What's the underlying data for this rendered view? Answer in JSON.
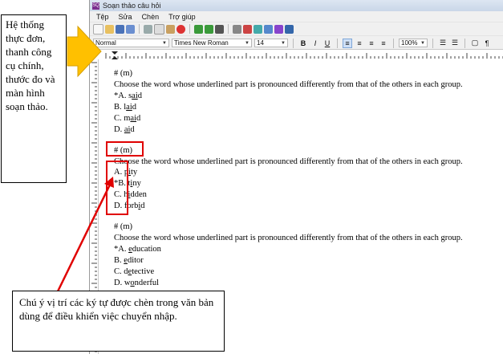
{
  "window": {
    "title": "Soạn thảo câu hỏi"
  },
  "menu": [
    "Tệp",
    "Sửa",
    "Chèn",
    "Trợ giúp"
  ],
  "format": {
    "style": "Normal",
    "font": "Times New Roman",
    "size": "14",
    "zoom": "100%"
  },
  "document": {
    "lines": [
      "# (m)",
      "Choose the word whose underlined part is pronounced differently from that of the others in each group.",
      "*A. said",
      "B. laid",
      "C. maid",
      "D. aid",
      "# (m)",
      "Choose the word whose underlined part is pronounced differently from that of the others in each group.",
      "A. pity",
      "*B. tiny",
      "C. hidden",
      "D. forbid",
      "# (m)",
      "Choose the word whose underlined part is pronounced differently from that of the others in each group.",
      "*A. education",
      "B. editor",
      "C. detective",
      "D. wonderful"
    ]
  },
  "callouts": {
    "top": "Hệ thống thực đơn, thanh công cụ chính, thước đo và màn hình soạn thảo.",
    "bottom": "Chú ý vị trí các ký tự được chèn trong văn bản dùng để điều khiển việc chuyển nhập."
  },
  "colors": {
    "arrow": "#ffc000",
    "highlight": "#e00000"
  }
}
